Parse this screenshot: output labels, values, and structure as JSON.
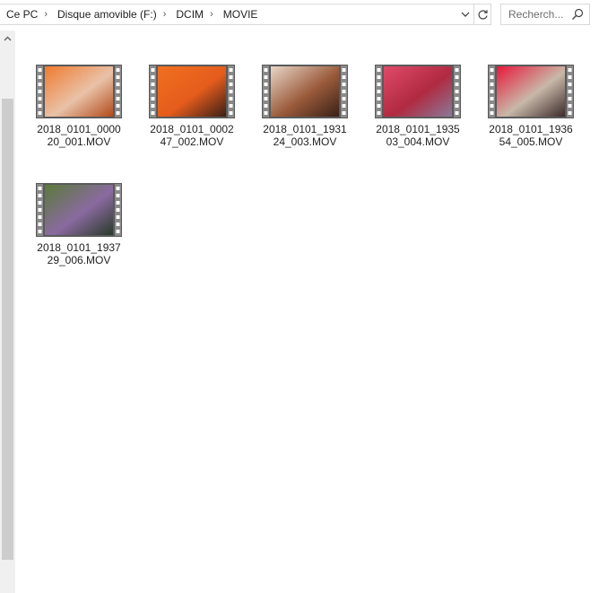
{
  "breadcrumb": [
    {
      "label": "Ce PC"
    },
    {
      "label": "Disque amovible (F:)"
    },
    {
      "label": "DCIM"
    },
    {
      "label": "MOVIE"
    }
  ],
  "search": {
    "placeholder": "Recherch..."
  },
  "icons": {
    "separator": "chevron-right-icon",
    "dropdown": "chevron-down-icon",
    "refresh": "refresh-icon",
    "search": "search-icon",
    "scroll_up": "chevron-up-icon",
    "video": "film-strip-icon"
  },
  "files": [
    {
      "name": "2018_0101_000020_001.MOV",
      "colors": [
        "#f07a2e",
        "#e9c2a8",
        "#b24a1a"
      ]
    },
    {
      "name": "2018_0101_000247_002.MOV",
      "colors": [
        "#f07020",
        "#e55c1c",
        "#3a1f16"
      ]
    },
    {
      "name": "2018_0101_193124_003.MOV",
      "colors": [
        "#e9d6c8",
        "#9a5a3a",
        "#3a2018"
      ]
    },
    {
      "name": "2018_0101_193503_004.MOV",
      "colors": [
        "#e04a6a",
        "#b02a40",
        "#8a7a9a"
      ]
    },
    {
      "name": "2018_0101_193654_005.MOV",
      "colors": [
        "#e8183a",
        "#c8b8a8",
        "#3a2a2a"
      ]
    },
    {
      "name": "2018_0101_193729_006.MOV",
      "colors": [
        "#5a7a3a",
        "#8a6aa0",
        "#2a3a2a"
      ]
    }
  ],
  "colors": {
    "selection": "#cce8ff",
    "border": "#d9d9d9",
    "scroll_track": "#f0f0f0",
    "scroll_thumb": "#cdcdcd"
  }
}
